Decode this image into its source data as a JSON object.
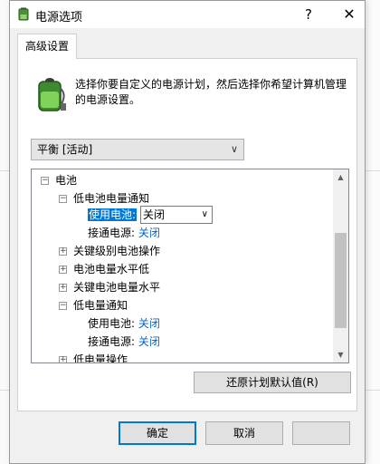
{
  "window": {
    "title": "电源选项",
    "help_label": "?",
    "close_label": "✕"
  },
  "tab": {
    "label": "高级设置"
  },
  "intro": {
    "text": "选择你要自定义的电源计划，然后选择你希望计算机管理的电源设置。"
  },
  "plan_select": {
    "value": "平衡 [活动]"
  },
  "tree": {
    "battery": "电池",
    "low_battery_notify": "低电池电量通知",
    "on_battery_label": "使用电池:",
    "on_battery_value": "关闭",
    "plugged_in_label": "接通电源:",
    "plugged_in_value": "关闭",
    "critical_action": "关键级别电池操作",
    "battery_level_low": "电池电量水平低",
    "critical_battery_level": "关键电池电量水平",
    "low_power_notify": "低电量通知",
    "low_power_on_battery_label": "使用电池:",
    "low_power_on_battery_value": "关闭",
    "low_power_plugged_label": "接通电源:",
    "low_power_plugged_value": "关闭",
    "low_power_action": "低电量操作"
  },
  "buttons": {
    "restore": "还原计划默认值(R)",
    "ok": "确定",
    "cancel": "取消"
  },
  "colors": {
    "accent": "#0078d7",
    "link_value": "#0066cc"
  }
}
